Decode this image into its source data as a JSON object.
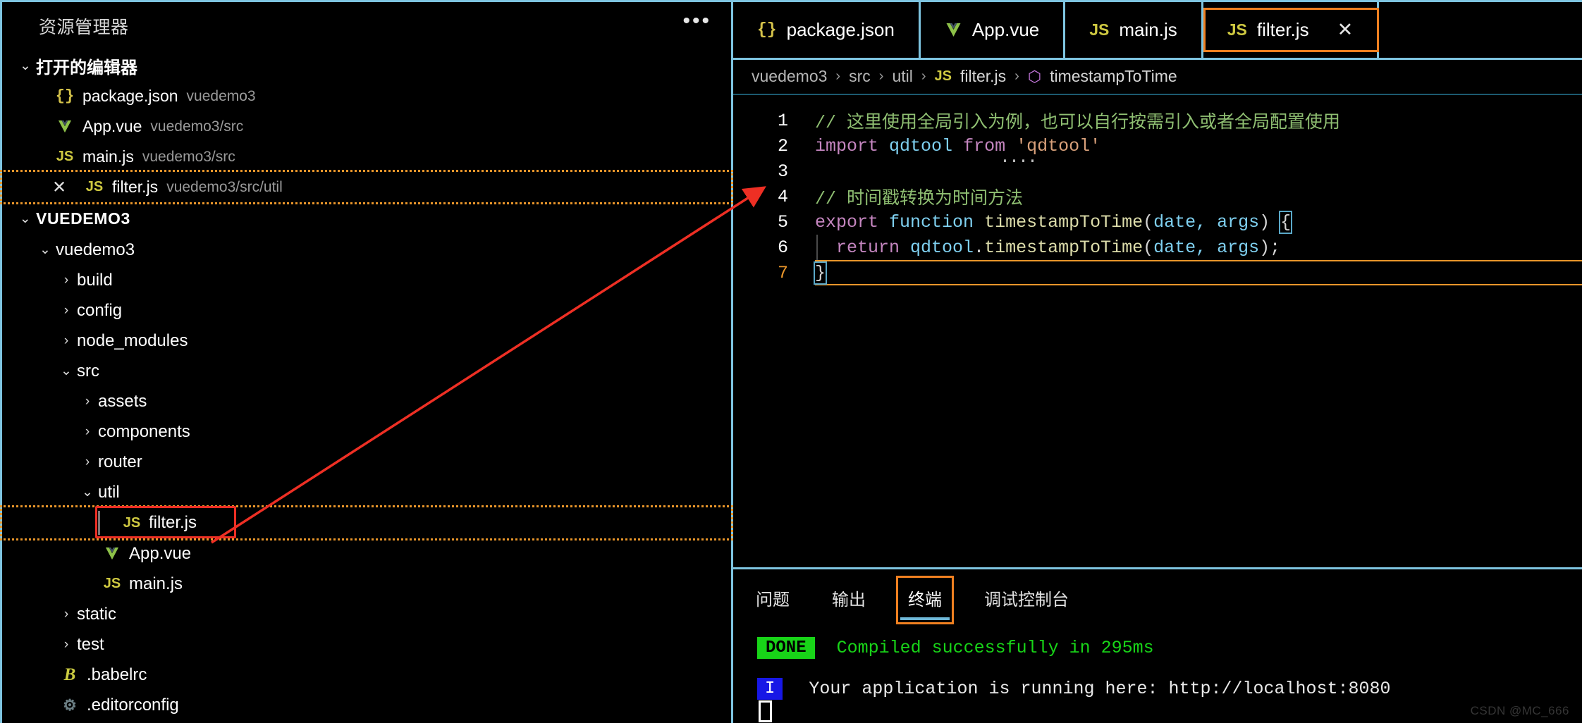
{
  "window": {
    "watermark": "CSDN @MC_666"
  },
  "sidebar": {
    "title": "资源管理器",
    "overflow_icon": "•••",
    "open_editors": {
      "label": "打开的编辑器",
      "chevron": "⌄",
      "items": [
        {
          "icon": "json-braces-icon",
          "icon_glyph": "{}",
          "name": "package.json",
          "path": "vuedemo3",
          "dirty": false,
          "close_glyph": ""
        },
        {
          "icon": "vue-icon",
          "icon_glyph": "V",
          "name": "App.vue",
          "path": "vuedemo3/src",
          "dirty": false,
          "close_glyph": ""
        },
        {
          "icon": "js-icon",
          "icon_glyph": "JS",
          "name": "main.js",
          "path": "vuedemo3/src",
          "dirty": false,
          "close_glyph": ""
        },
        {
          "icon": "js-icon",
          "icon_glyph": "JS",
          "name": "filter.js",
          "path": "vuedemo3/src/util",
          "dirty": true,
          "close_glyph": "✕"
        }
      ]
    },
    "project": {
      "root_label": "VUEDEMO3",
      "chevron": "⌄",
      "tree": [
        {
          "depth": 0,
          "arrow": "⌄",
          "label": "vuedemo3",
          "icon": "",
          "icon_glyph": "",
          "type": "folder"
        },
        {
          "depth": 1,
          "arrow": "›",
          "label": "build",
          "icon": "",
          "icon_glyph": "",
          "type": "folder"
        },
        {
          "depth": 1,
          "arrow": "›",
          "label": "config",
          "icon": "",
          "icon_glyph": "",
          "type": "folder"
        },
        {
          "depth": 1,
          "arrow": "›",
          "label": "node_modules",
          "icon": "",
          "icon_glyph": "",
          "type": "folder"
        },
        {
          "depth": 1,
          "arrow": "⌄",
          "label": "src",
          "icon": "",
          "icon_glyph": "",
          "type": "folder"
        },
        {
          "depth": 2,
          "arrow": "›",
          "label": "assets",
          "icon": "",
          "icon_glyph": "",
          "type": "folder"
        },
        {
          "depth": 2,
          "arrow": "›",
          "label": "components",
          "icon": "",
          "icon_glyph": "",
          "type": "folder"
        },
        {
          "depth": 2,
          "arrow": "›",
          "label": "router",
          "icon": "",
          "icon_glyph": "",
          "type": "folder"
        },
        {
          "depth": 2,
          "arrow": "⌄",
          "label": "util",
          "icon": "",
          "icon_glyph": "",
          "type": "folder"
        },
        {
          "depth": 3,
          "arrow": "",
          "label": "filter.js",
          "icon": "js-icon",
          "icon_glyph": "JS",
          "type": "file",
          "highlighted": true
        },
        {
          "depth": 2,
          "arrow": "",
          "label": "App.vue",
          "icon": "vue-icon",
          "icon_glyph": "V",
          "type": "file"
        },
        {
          "depth": 2,
          "arrow": "",
          "label": "main.js",
          "icon": "js-icon",
          "icon_glyph": "JS",
          "type": "file"
        },
        {
          "depth": 1,
          "arrow": "›",
          "label": "static",
          "icon": "",
          "icon_glyph": "",
          "type": "folder"
        },
        {
          "depth": 1,
          "arrow": "›",
          "label": "test",
          "icon": "",
          "icon_glyph": "",
          "type": "folder"
        },
        {
          "depth": 1,
          "arrow": "",
          "label": ".babelrc",
          "icon": "babel-icon",
          "icon_glyph": "B",
          "type": "file"
        },
        {
          "depth": 1,
          "arrow": "",
          "label": ".editorconfig",
          "icon": "gear-icon",
          "icon_glyph": "⚙",
          "type": "file"
        }
      ]
    }
  },
  "editor_group": {
    "tabs": [
      {
        "icon": "json-braces-icon",
        "icon_glyph": "{}",
        "label": "package.json",
        "active": false,
        "close_glyph": ""
      },
      {
        "icon": "vue-icon",
        "icon_glyph": "V",
        "label": "App.vue",
        "active": false,
        "close_glyph": ""
      },
      {
        "icon": "js-icon",
        "icon_glyph": "JS",
        "label": "main.js",
        "active": false,
        "close_glyph": ""
      },
      {
        "icon": "js-icon",
        "icon_glyph": "JS",
        "label": "filter.js",
        "active": true,
        "close_glyph": "✕"
      }
    ],
    "breadcrumb": [
      {
        "label": "vuedemo3",
        "icon": ""
      },
      {
        "label": "src",
        "icon": ""
      },
      {
        "label": "util",
        "icon": ""
      },
      {
        "label": "filter.js",
        "icon": "js-icon",
        "icon_glyph": "JS"
      },
      {
        "label": "timestampToTime",
        "icon": "symbol-method-icon",
        "icon_glyph": "⬡"
      }
    ],
    "breadcrumb_separator": "›"
  },
  "code": {
    "language": "javascript",
    "current_line": 7,
    "lines": [
      {
        "n": "1",
        "tokens": [
          {
            "t": "// 这里使用全局引入为例，也可以自行按需引入或者全局配置使用",
            "c": "c-com"
          }
        ]
      },
      {
        "n": "2",
        "tokens": [
          {
            "t": "import ",
            "c": "c-kw"
          },
          {
            "t": "qdtool ",
            "c": "c-var"
          },
          {
            "t": "from ",
            "c": "c-kw"
          },
          {
            "t": "'qdtool'",
            "c": "c-str"
          }
        ]
      },
      {
        "n": "3",
        "tokens": [
          {
            "t": "",
            "c": "c-plain"
          }
        ]
      },
      {
        "n": "4",
        "tokens": [
          {
            "t": "// 时间戳转换为时间方法",
            "c": "c-com"
          }
        ]
      },
      {
        "n": "5",
        "tokens": [
          {
            "t": "export ",
            "c": "c-kw"
          },
          {
            "t": "function ",
            "c": "c-blue"
          },
          {
            "t": "timestampToTime",
            "c": "c-fn"
          },
          {
            "t": "(",
            "c": "c-plain"
          },
          {
            "t": "date, args",
            "c": "c-var"
          },
          {
            "t": ") ",
            "c": "c-plain"
          }
        ]
      },
      {
        "n": "6",
        "tokens": [
          {
            "t": "  return ",
            "c": "c-kw"
          },
          {
            "t": "qdtool",
            "c": "c-var"
          },
          {
            "t": ".",
            "c": "c-plain"
          },
          {
            "t": "timestampToTime",
            "c": "c-fn"
          },
          {
            "t": "(",
            "c": "c-plain"
          },
          {
            "t": "date, args",
            "c": "c-var"
          },
          {
            "t": ");",
            "c": "c-plain"
          }
        ]
      },
      {
        "n": "7",
        "tokens": []
      }
    ],
    "bracket_open": "{",
    "bracket_close": "}",
    "error_dots": "...."
  },
  "panel": {
    "tabs": [
      {
        "label": "问题",
        "active": false
      },
      {
        "label": "输出",
        "active": false
      },
      {
        "label": "终端",
        "active": true
      },
      {
        "label": "调试控制台",
        "active": false
      }
    ],
    "terminal_lines": [
      {
        "badge": "DONE",
        "badge_color": "#18d418",
        "text": " Compiled successfully in 295ms",
        "text_color": "#18d418"
      },
      {
        "badge": "I",
        "badge_color": "#1717e6",
        "text": " Your application is running here: http://localhost:8080",
        "text_color": "#e9e9e9"
      }
    ]
  },
  "colors": {
    "accent_border": "#7ec4e0",
    "annotation_orange": "#f08020",
    "annotation_red": "#ee2f24",
    "terminal_green": "#18d418",
    "terminal_blue": "#1717e6"
  }
}
